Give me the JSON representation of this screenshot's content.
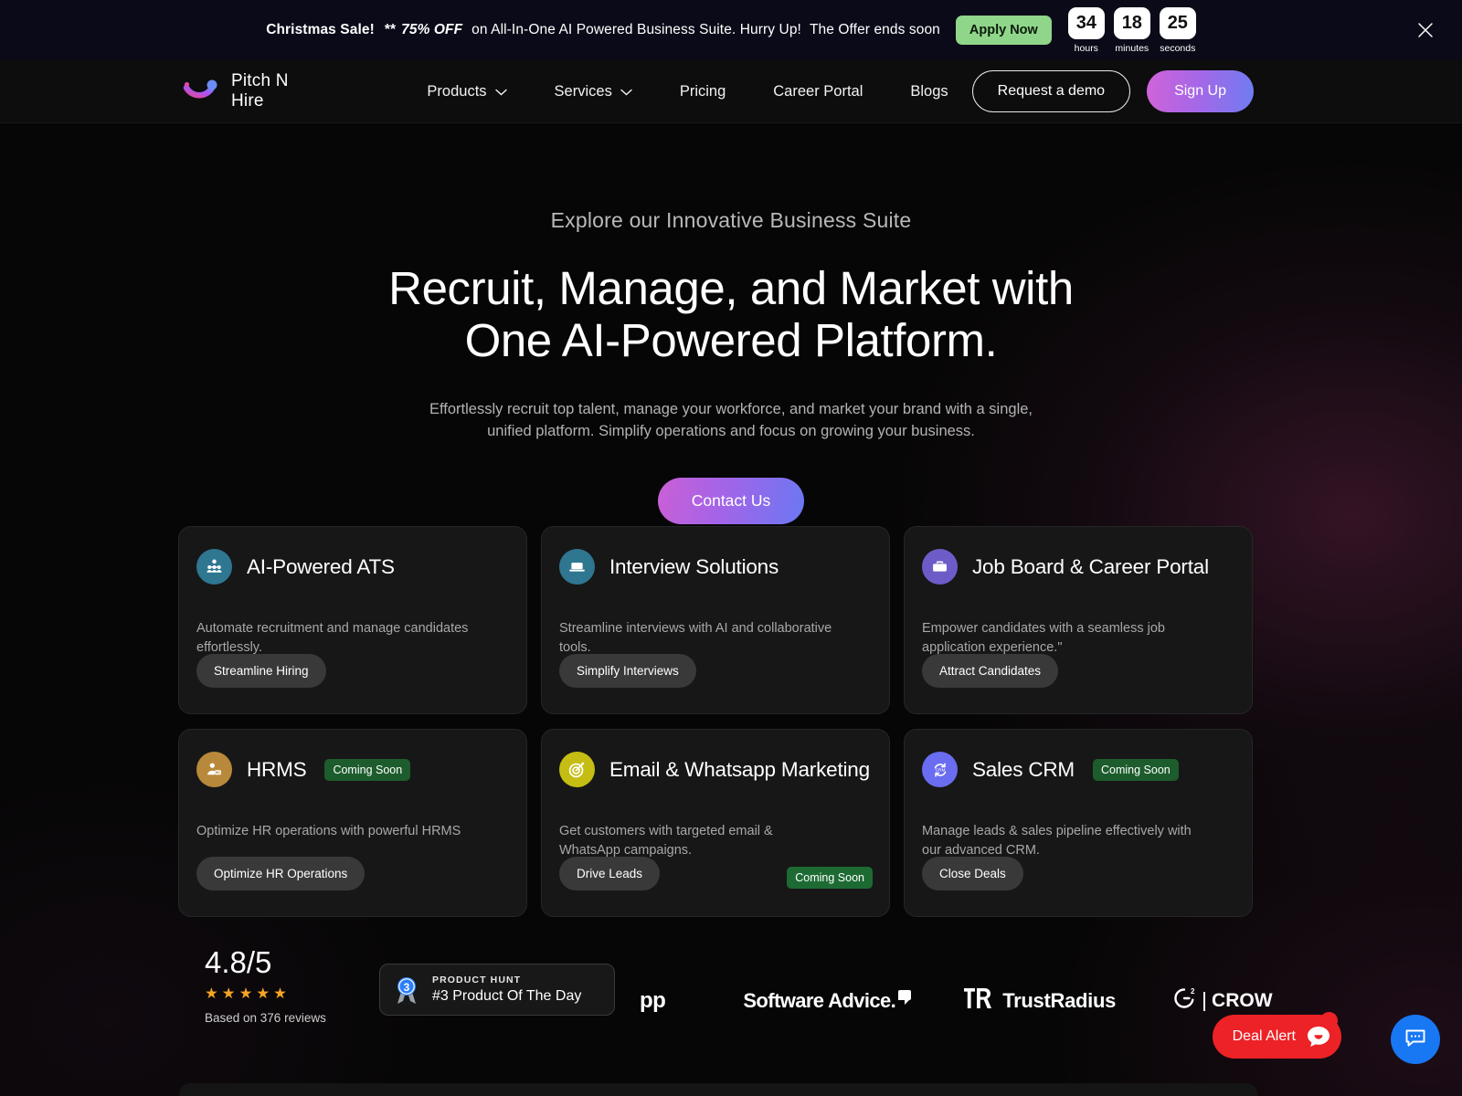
{
  "promo": {
    "sale_label": "Christmas Sale!",
    "stars": "**",
    "discount": "75% OFF",
    "offer_text": "on All-In-One AI Powered Business Suite. Hurry Up!",
    "ends_text": "The Offer ends soon",
    "apply_label": "Apply Now",
    "timer": [
      {
        "value": "34",
        "label": "hours"
      },
      {
        "value": "18",
        "label": "minutes"
      },
      {
        "value": "25",
        "label": "seconds"
      }
    ],
    "close_icon": "close-icon",
    "bg_color": "#0a0a18",
    "apply_color": "#8fd68a"
  },
  "nav": {
    "brand": "Pitch N Hire",
    "logo_icon": "pitch-n-hire-logo",
    "links": [
      {
        "label": "Products",
        "has_dropdown": true
      },
      {
        "label": "Services",
        "has_dropdown": true
      },
      {
        "label": "Pricing",
        "has_dropdown": false
      },
      {
        "label": "Career Portal",
        "has_dropdown": false
      },
      {
        "label": "Blogs",
        "has_dropdown": false
      }
    ],
    "demo_label": "Request a demo",
    "signup_label": "Sign Up",
    "signup_gradient": "#d163d8 → #6f7cf0"
  },
  "hero": {
    "eyebrow": "Explore our Innovative Business Suite",
    "headline_line1": "Recruit, Manage, and Market with",
    "headline_line2": "One AI-Powered Platform.",
    "subhead_line1": "Effortlessly recruit top talent, manage your workforce, and market your brand with a single,",
    "subhead_line2": "unified platform. Simplify operations and focus on growing your business.",
    "cta_label": "Contact Us",
    "cta_gradient": "#cb5fd6 → #6b78f2"
  },
  "cards": [
    {
      "title": "AI-Powered ATS",
      "icon": "people-group-icon",
      "icon_color": "#2f7691",
      "desc": "Automate recruitment and manage candidates effortlessly.",
      "button": "Streamline Hiring",
      "badge": null,
      "badge_bottom": null
    },
    {
      "title": "Interview Solutions",
      "icon": "laptop-icon",
      "icon_color": "#2f7691",
      "desc": "Streamline interviews with AI and collaborative tools.",
      "button": "Simplify Interviews",
      "badge": null,
      "badge_bottom": null
    },
    {
      "title": "Job Board & Career Portal",
      "icon": "briefcase-icon",
      "icon_color": "#6d5cc8",
      "desc": "Empower candidates with a seamless job application experience.\"",
      "button": "Attract Candidates",
      "badge": null,
      "badge_bottom": null
    },
    {
      "title": "HRMS",
      "icon": "employee-badge-icon",
      "icon_color": "#b8893a",
      "desc": "Optimize HR operations with powerful HRMS",
      "button": "Optimize HR Operations",
      "badge": "Coming Soon",
      "badge_bottom": null
    },
    {
      "title": "Email & Whatsapp Marketing",
      "icon": "target-icon",
      "icon_color": "#c5bd14",
      "desc": "Get customers with targeted email & WhatsApp campaigns.",
      "button": "Drive Leads",
      "badge": null,
      "badge_bottom": "Coming Soon"
    },
    {
      "title": "Sales CRM",
      "icon": "crm-cycle-icon",
      "icon_color": "#6a6df0",
      "desc": "Manage leads & sales pipeline effectively with our advanced CRM.",
      "button": "Close Deals",
      "badge": "Coming Soon",
      "badge_bottom": null
    }
  ],
  "proof": {
    "rating_score": "4.8/5",
    "rating_stars": "★★★★★",
    "rating_sub": "Based on 376 reviews",
    "product_hunt": {
      "badge_number": "3",
      "label": "PRODUCT HUNT",
      "title": "#3 Product Of The Day"
    },
    "logos": [
      {
        "name": "pp",
        "text": "pp"
      },
      {
        "name": "software-advice",
        "text": "Software Advice."
      },
      {
        "name": "trustradius",
        "text": "TrustRadius"
      },
      {
        "name": "g2-crowd",
        "text": "CROW"
      }
    ]
  },
  "widgets": {
    "deal_alert_label": "Deal Alert",
    "deal_alert_color": "#ec2227",
    "deal_alert_icon": "smiley-chat-bubble-icon",
    "chat_icon": "chat-bubble-icon",
    "chat_color": "#1877f2"
  }
}
